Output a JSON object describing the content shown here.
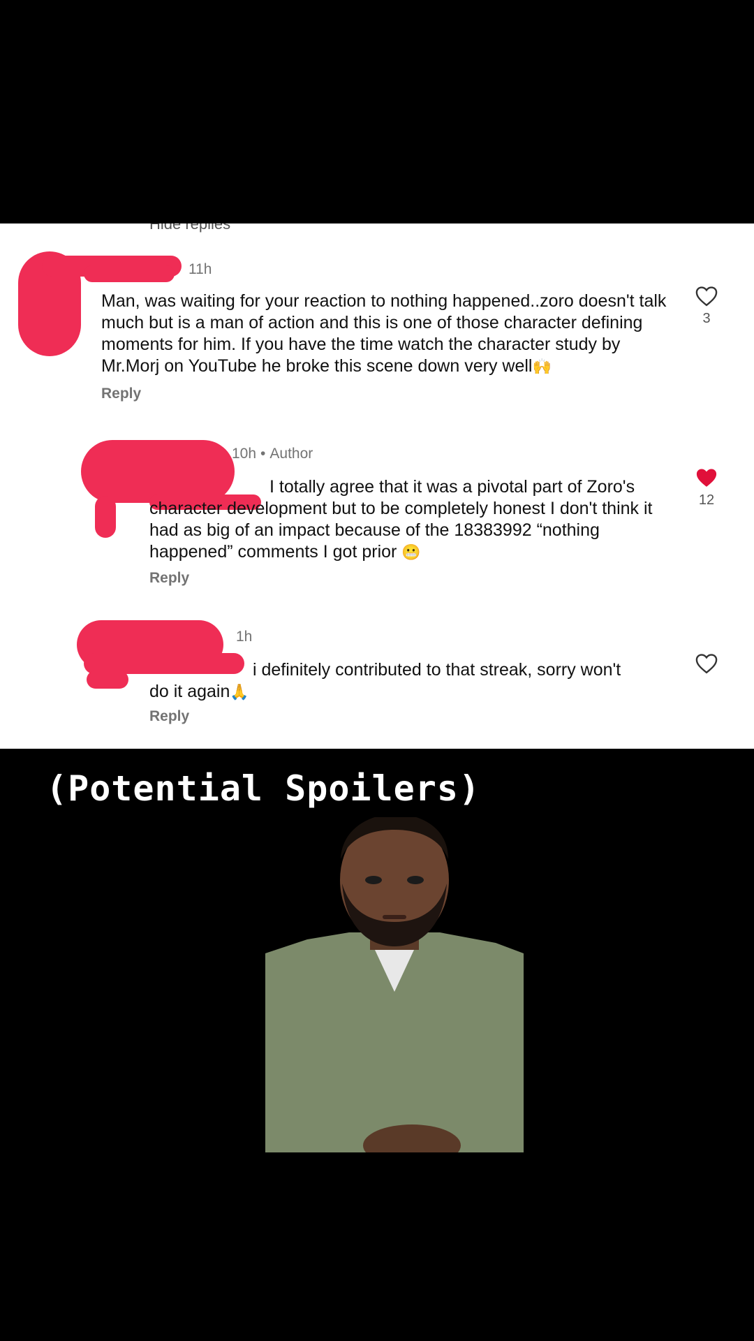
{
  "thread": {
    "hide_replies_label": "Hide replies"
  },
  "comments": [
    {
      "timestamp": "11h",
      "text": "Man, was waiting for your reaction to nothing happened..zoro doesn't talk much but is a man of action and this is one of those character defining moments for him. If you have the time watch the character study by Mr.Morj on YouTube he broke this scene down very well",
      "emoji": "🙌",
      "reply_label": "Reply",
      "likes": "3",
      "liked": false
    },
    {
      "timestamp": "10h",
      "author_badge": "Author",
      "text_line1": "I totally agree that it was a pivotal part of Zoro's",
      "text_rest": "character development but to be completely honest I don't think it had as big of an impact because of the 18383992 “nothing happened” comments I got prior",
      "emoji": "😬",
      "reply_label": "Reply",
      "likes": "12",
      "liked": true
    },
    {
      "timestamp": "1h",
      "text_line1": "i definitely contributed to that streak, sorry won't",
      "text_rest": "do it again",
      "emoji": "🙏",
      "reply_label": "Reply",
      "liked": false
    }
  ],
  "overlay": {
    "caption": "(Potential Spoilers)"
  },
  "colors": {
    "heart_liked": "#e0103a",
    "redaction": "#ef2d55"
  }
}
